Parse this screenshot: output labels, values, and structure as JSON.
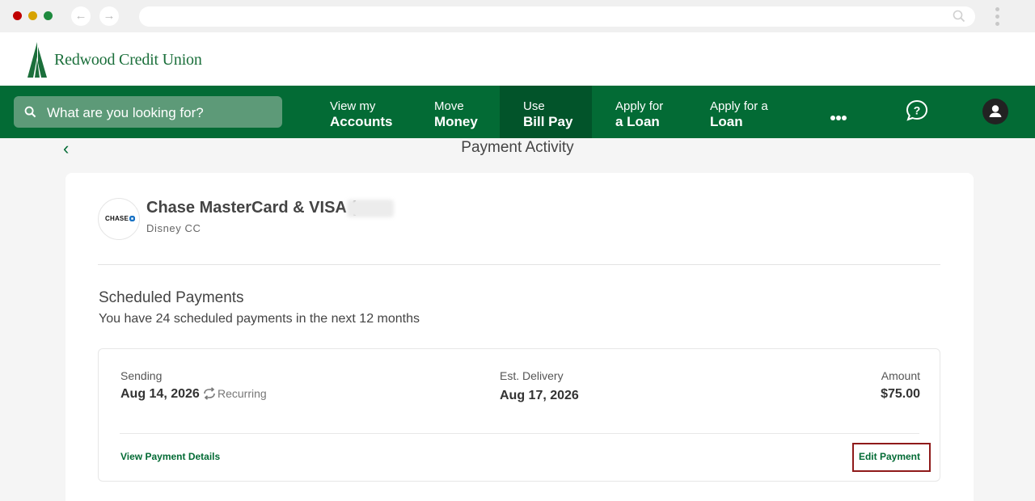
{
  "browser": {
    "back_glyph": "←",
    "forward_glyph": "→",
    "address": ""
  },
  "brand": {
    "name": "Redwood Credit Union",
    "color": "#036b35"
  },
  "search": {
    "placeholder": "What are you looking for?"
  },
  "nav": {
    "items": [
      {
        "line1": "View my",
        "line2": "Accounts",
        "active": false
      },
      {
        "line1": "Move",
        "line2": "Money",
        "active": false
      },
      {
        "line1": "Use",
        "line2": "Bill Pay",
        "active": true
      },
      {
        "line1": "Apply for",
        "line2": "a Loan",
        "active": false
      },
      {
        "line1": "Apply for a",
        "line2": "Loan",
        "active": false
      }
    ],
    "more_icon": "more-horizontal-icon",
    "help_icon": "help-chat-icon",
    "user_icon": "user-avatar-icon"
  },
  "page": {
    "title": "Payment Activity",
    "back_glyph": "‹"
  },
  "payee": {
    "logo_text": "CHASE",
    "name": "Chase MasterCard & VISA (••",
    "nickname": "Disney CC"
  },
  "scheduled": {
    "title": "Scheduled Payments",
    "subtitle": "You have 24 scheduled payments in the next 12 months",
    "payments": [
      {
        "sending_label": "Sending",
        "sending_date": "Aug 14, 2026",
        "recurring_label": "Recurring",
        "delivery_label": "Est. Delivery",
        "delivery_date": "Aug 17, 2026",
        "amount_label": "Amount",
        "amount": "$75.00",
        "details_link": "View Payment Details",
        "edit_link": "Edit Payment"
      }
    ]
  },
  "colors": {
    "nav_green": "#036b35",
    "nav_active": "#02542a",
    "highlight_border": "#8f1a1a"
  }
}
